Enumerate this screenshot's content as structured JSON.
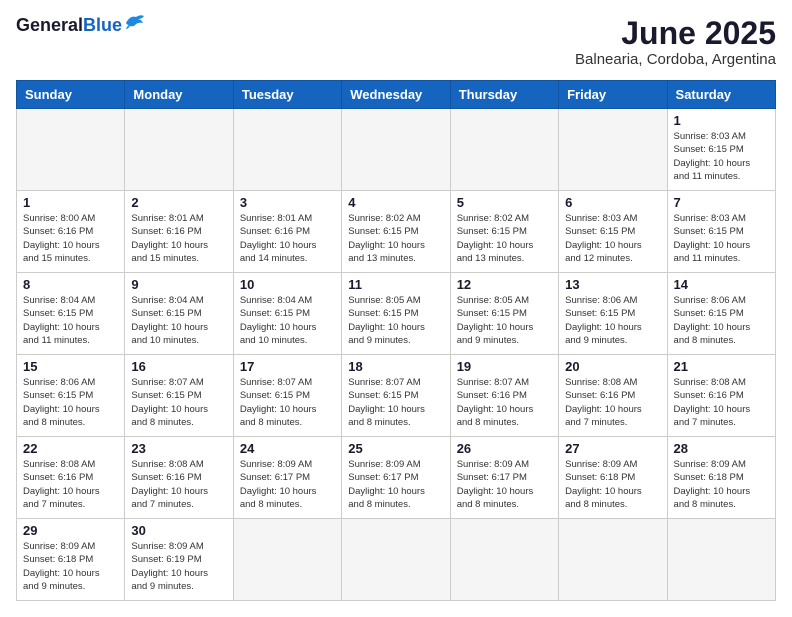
{
  "header": {
    "logo_general": "General",
    "logo_blue": "Blue",
    "title": "June 2025",
    "subtitle": "Balnearia, Cordoba, Argentina"
  },
  "calendar": {
    "days_of_week": [
      "Sunday",
      "Monday",
      "Tuesday",
      "Wednesday",
      "Thursday",
      "Friday",
      "Saturday"
    ],
    "weeks": [
      [
        {
          "day": "",
          "empty": true
        },
        {
          "day": "",
          "empty": true
        },
        {
          "day": "",
          "empty": true
        },
        {
          "day": "",
          "empty": true
        },
        {
          "day": "",
          "empty": true
        },
        {
          "day": "",
          "empty": true
        },
        {
          "day": "1",
          "sunrise": "Sunrise: 8:03 AM",
          "sunset": "Sunset: 6:15 PM",
          "daylight": "Daylight: 10 hours and 11 minutes."
        }
      ],
      [
        {
          "day": "1",
          "sunrise": "Sunrise: 8:00 AM",
          "sunset": "Sunset: 6:16 PM",
          "daylight": "Daylight: 10 hours and 15 minutes."
        },
        {
          "day": "2",
          "sunrise": "Sunrise: 8:01 AM",
          "sunset": "Sunset: 6:16 PM",
          "daylight": "Daylight: 10 hours and 15 minutes."
        },
        {
          "day": "3",
          "sunrise": "Sunrise: 8:01 AM",
          "sunset": "Sunset: 6:16 PM",
          "daylight": "Daylight: 10 hours and 14 minutes."
        },
        {
          "day": "4",
          "sunrise": "Sunrise: 8:02 AM",
          "sunset": "Sunset: 6:15 PM",
          "daylight": "Daylight: 10 hours and 13 minutes."
        },
        {
          "day": "5",
          "sunrise": "Sunrise: 8:02 AM",
          "sunset": "Sunset: 6:15 PM",
          "daylight": "Daylight: 10 hours and 13 minutes."
        },
        {
          "day": "6",
          "sunrise": "Sunrise: 8:03 AM",
          "sunset": "Sunset: 6:15 PM",
          "daylight": "Daylight: 10 hours and 12 minutes."
        },
        {
          "day": "7",
          "sunrise": "Sunrise: 8:03 AM",
          "sunset": "Sunset: 6:15 PM",
          "daylight": "Daylight: 10 hours and 11 minutes."
        }
      ],
      [
        {
          "day": "8",
          "sunrise": "Sunrise: 8:04 AM",
          "sunset": "Sunset: 6:15 PM",
          "daylight": "Daylight: 10 hours and 11 minutes."
        },
        {
          "day": "9",
          "sunrise": "Sunrise: 8:04 AM",
          "sunset": "Sunset: 6:15 PM",
          "daylight": "Daylight: 10 hours and 10 minutes."
        },
        {
          "day": "10",
          "sunrise": "Sunrise: 8:04 AM",
          "sunset": "Sunset: 6:15 PM",
          "daylight": "Daylight: 10 hours and 10 minutes."
        },
        {
          "day": "11",
          "sunrise": "Sunrise: 8:05 AM",
          "sunset": "Sunset: 6:15 PM",
          "daylight": "Daylight: 10 hours and 9 minutes."
        },
        {
          "day": "12",
          "sunrise": "Sunrise: 8:05 AM",
          "sunset": "Sunset: 6:15 PM",
          "daylight": "Daylight: 10 hours and 9 minutes."
        },
        {
          "day": "13",
          "sunrise": "Sunrise: 8:06 AM",
          "sunset": "Sunset: 6:15 PM",
          "daylight": "Daylight: 10 hours and 9 minutes."
        },
        {
          "day": "14",
          "sunrise": "Sunrise: 8:06 AM",
          "sunset": "Sunset: 6:15 PM",
          "daylight": "Daylight: 10 hours and 8 minutes."
        }
      ],
      [
        {
          "day": "15",
          "sunrise": "Sunrise: 8:06 AM",
          "sunset": "Sunset: 6:15 PM",
          "daylight": "Daylight: 10 hours and 8 minutes."
        },
        {
          "day": "16",
          "sunrise": "Sunrise: 8:07 AM",
          "sunset": "Sunset: 6:15 PM",
          "daylight": "Daylight: 10 hours and 8 minutes."
        },
        {
          "day": "17",
          "sunrise": "Sunrise: 8:07 AM",
          "sunset": "Sunset: 6:15 PM",
          "daylight": "Daylight: 10 hours and 8 minutes."
        },
        {
          "day": "18",
          "sunrise": "Sunrise: 8:07 AM",
          "sunset": "Sunset: 6:15 PM",
          "daylight": "Daylight: 10 hours and 8 minutes."
        },
        {
          "day": "19",
          "sunrise": "Sunrise: 8:07 AM",
          "sunset": "Sunset: 6:16 PM",
          "daylight": "Daylight: 10 hours and 8 minutes."
        },
        {
          "day": "20",
          "sunrise": "Sunrise: 8:08 AM",
          "sunset": "Sunset: 6:16 PM",
          "daylight": "Daylight: 10 hours and 7 minutes."
        },
        {
          "day": "21",
          "sunrise": "Sunrise: 8:08 AM",
          "sunset": "Sunset: 6:16 PM",
          "daylight": "Daylight: 10 hours and 7 minutes."
        }
      ],
      [
        {
          "day": "22",
          "sunrise": "Sunrise: 8:08 AM",
          "sunset": "Sunset: 6:16 PM",
          "daylight": "Daylight: 10 hours and 7 minutes."
        },
        {
          "day": "23",
          "sunrise": "Sunrise: 8:08 AM",
          "sunset": "Sunset: 6:16 PM",
          "daylight": "Daylight: 10 hours and 7 minutes."
        },
        {
          "day": "24",
          "sunrise": "Sunrise: 8:09 AM",
          "sunset": "Sunset: 6:17 PM",
          "daylight": "Daylight: 10 hours and 8 minutes."
        },
        {
          "day": "25",
          "sunrise": "Sunrise: 8:09 AM",
          "sunset": "Sunset: 6:17 PM",
          "daylight": "Daylight: 10 hours and 8 minutes."
        },
        {
          "day": "26",
          "sunrise": "Sunrise: 8:09 AM",
          "sunset": "Sunset: 6:17 PM",
          "daylight": "Daylight: 10 hours and 8 minutes."
        },
        {
          "day": "27",
          "sunrise": "Sunrise: 8:09 AM",
          "sunset": "Sunset: 6:18 PM",
          "daylight": "Daylight: 10 hours and 8 minutes."
        },
        {
          "day": "28",
          "sunrise": "Sunrise: 8:09 AM",
          "sunset": "Sunset: 6:18 PM",
          "daylight": "Daylight: 10 hours and 8 minutes."
        }
      ],
      [
        {
          "day": "29",
          "sunrise": "Sunrise: 8:09 AM",
          "sunset": "Sunset: 6:18 PM",
          "daylight": "Daylight: 10 hours and 9 minutes."
        },
        {
          "day": "30",
          "sunrise": "Sunrise: 8:09 AM",
          "sunset": "Sunset: 6:19 PM",
          "daylight": "Daylight: 10 hours and 9 minutes."
        },
        {
          "day": "",
          "empty": true
        },
        {
          "day": "",
          "empty": true
        },
        {
          "day": "",
          "empty": true
        },
        {
          "day": "",
          "empty": true
        },
        {
          "day": "",
          "empty": true
        }
      ]
    ]
  }
}
